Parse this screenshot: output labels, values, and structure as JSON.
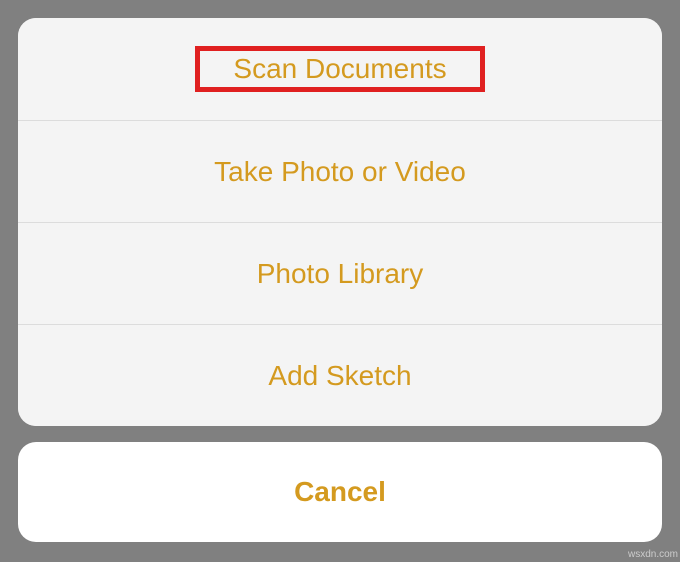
{
  "actionSheet": {
    "options": [
      {
        "label": "Scan Documents",
        "highlighted": true
      },
      {
        "label": "Take Photo or Video",
        "highlighted": false
      },
      {
        "label": "Photo Library",
        "highlighted": false
      },
      {
        "label": "Add Sketch",
        "highlighted": false
      }
    ],
    "cancel_label": "Cancel"
  },
  "colors": {
    "accent": "#d49a1f",
    "highlight_border": "#e02020",
    "background": "#808080",
    "sheet_bg": "#f4f4f4",
    "cancel_bg": "#ffffff"
  },
  "watermark": "wsxdn.com"
}
